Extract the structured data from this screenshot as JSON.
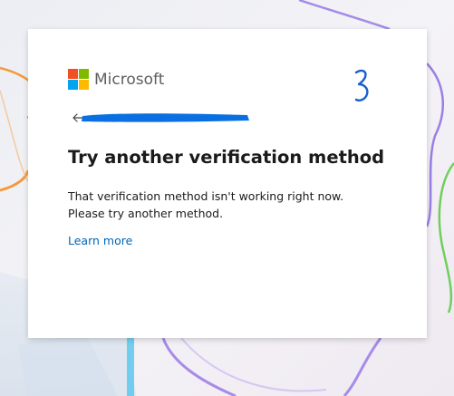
{
  "brand": {
    "name": "Microsoft",
    "logo_colors": [
      "#f25022",
      "#7fba00",
      "#00a4ef",
      "#ffb900"
    ]
  },
  "annotation": {
    "text": "3",
    "color": "#1a5fd0"
  },
  "back": {
    "icon": "arrow-left-icon",
    "redaction_color": "#0a6fe0"
  },
  "heading": {
    "title": "Try another verification method"
  },
  "message": {
    "line1": "That verification method isn't working right now.",
    "line2": "Please try another method."
  },
  "links": {
    "learn_more": "Learn more"
  },
  "colors": {
    "link": "#0067b8",
    "text": "#1b1b1b",
    "card": "#ffffff"
  }
}
